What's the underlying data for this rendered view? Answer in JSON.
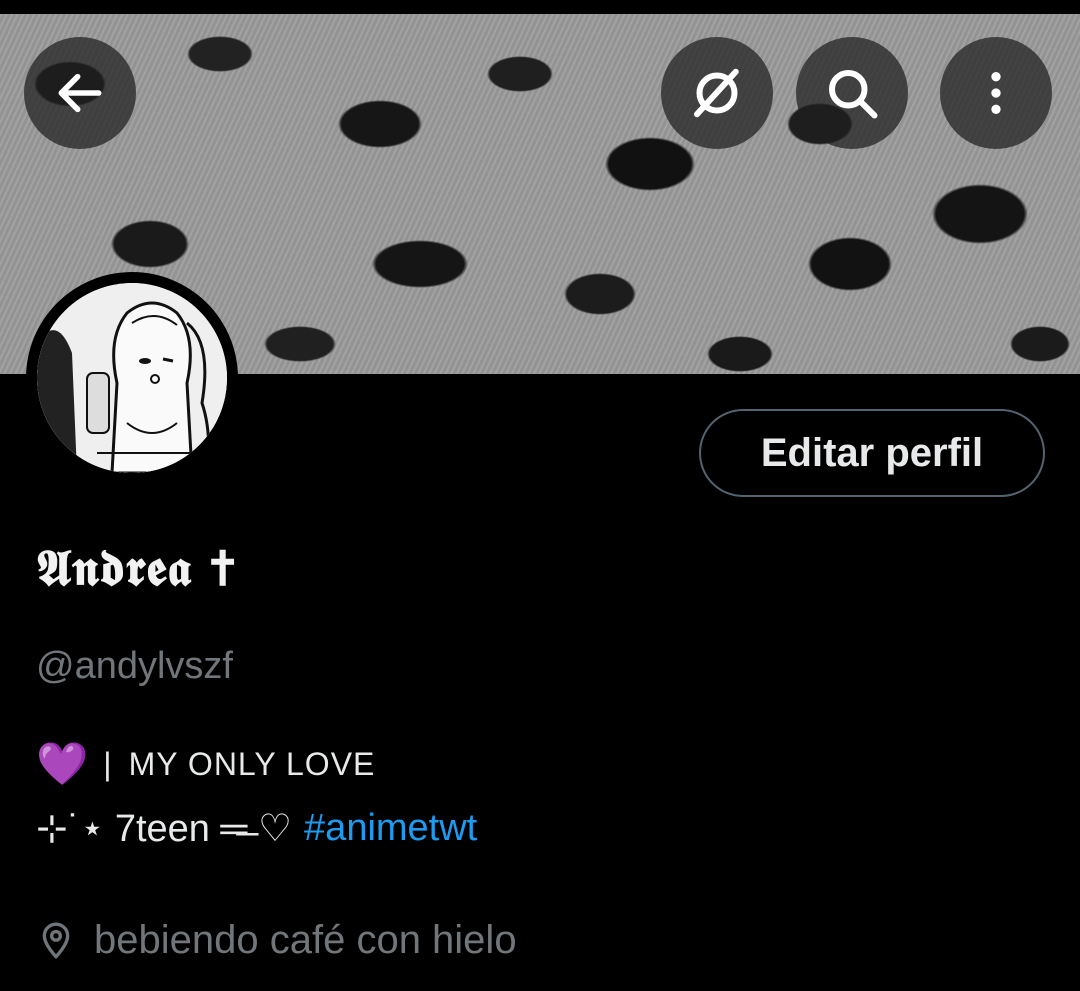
{
  "header": {
    "back_icon": "arrow-left-icon",
    "grok_icon": "grok-icon",
    "search_icon": "search-icon",
    "more_icon": "more-vertical-icon"
  },
  "profile": {
    "edit_button_label": "Editar perfil",
    "display_name": "𝕬𝖓𝖉𝖗𝖊𝖆 ✝",
    "handle": "@andylvszf",
    "bio_line1_emoji": "💜",
    "bio_line1_separator": "|",
    "bio_line1_text": "MY ONLY LOVE",
    "bio_line2_text": "⊹˙⋆ 7teen ═̶̶ ♡",
    "bio_line2_hashtag": "#animetwt",
    "location": "bebiendo café con hielo"
  },
  "colors": {
    "background": "#000000",
    "primary_text": "#e7e9ea",
    "secondary_text": "#71767b",
    "link": "#1d9bf0",
    "button_border": "#536471"
  }
}
